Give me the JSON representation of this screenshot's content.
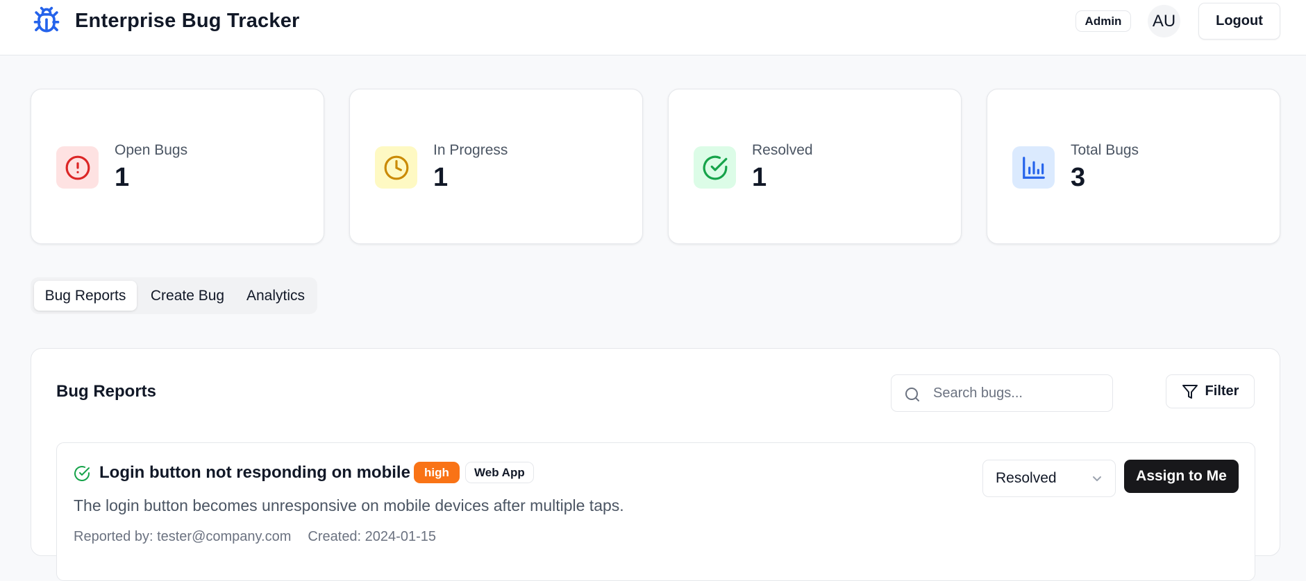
{
  "app": {
    "title": "Enterprise Bug Tracker",
    "brand_icon": "bug-icon",
    "role": "Admin",
    "avatar_initials": "AU",
    "logout_label": "Logout"
  },
  "stats": [
    {
      "label": "Open Bugs",
      "value": "1",
      "icon": "alert-circle-icon",
      "color": "#dc2626",
      "bg": "#fee2e2"
    },
    {
      "label": "In Progress",
      "value": "1",
      "icon": "clock-icon",
      "color": "#ca8a04",
      "bg": "#fef9c3"
    },
    {
      "label": "Resolved",
      "value": "1",
      "icon": "check-circle-icon",
      "color": "#16a34a",
      "bg": "#dcfce7"
    },
    {
      "label": "Total Bugs",
      "value": "3",
      "icon": "bar-chart-icon",
      "color": "#2563eb",
      "bg": "#dbeafe"
    }
  ],
  "tabs": [
    {
      "label": "Bug Reports",
      "active": true
    },
    {
      "label": "Create Bug",
      "active": false
    },
    {
      "label": "Analytics",
      "active": false
    }
  ],
  "panel": {
    "title": "Bug Reports",
    "search_placeholder": "Search bugs...",
    "search_value": "",
    "filter_label": "Filter",
    "filter_icon": "filter-icon",
    "search_icon": "search-icon"
  },
  "bugs": [
    {
      "title": "Login button not responding on mobile",
      "status_icon": "check-circle-icon",
      "priority": "high",
      "priority_color": "#f97316",
      "component": "Web App",
      "description": "The login button becomes unresponsive on mobile devices after multiple taps.",
      "reported_by": "Reported by: tester@company.com",
      "created": "Created: 2024-01-15",
      "status": "Resolved",
      "assign_label": "Assign to Me"
    }
  ]
}
